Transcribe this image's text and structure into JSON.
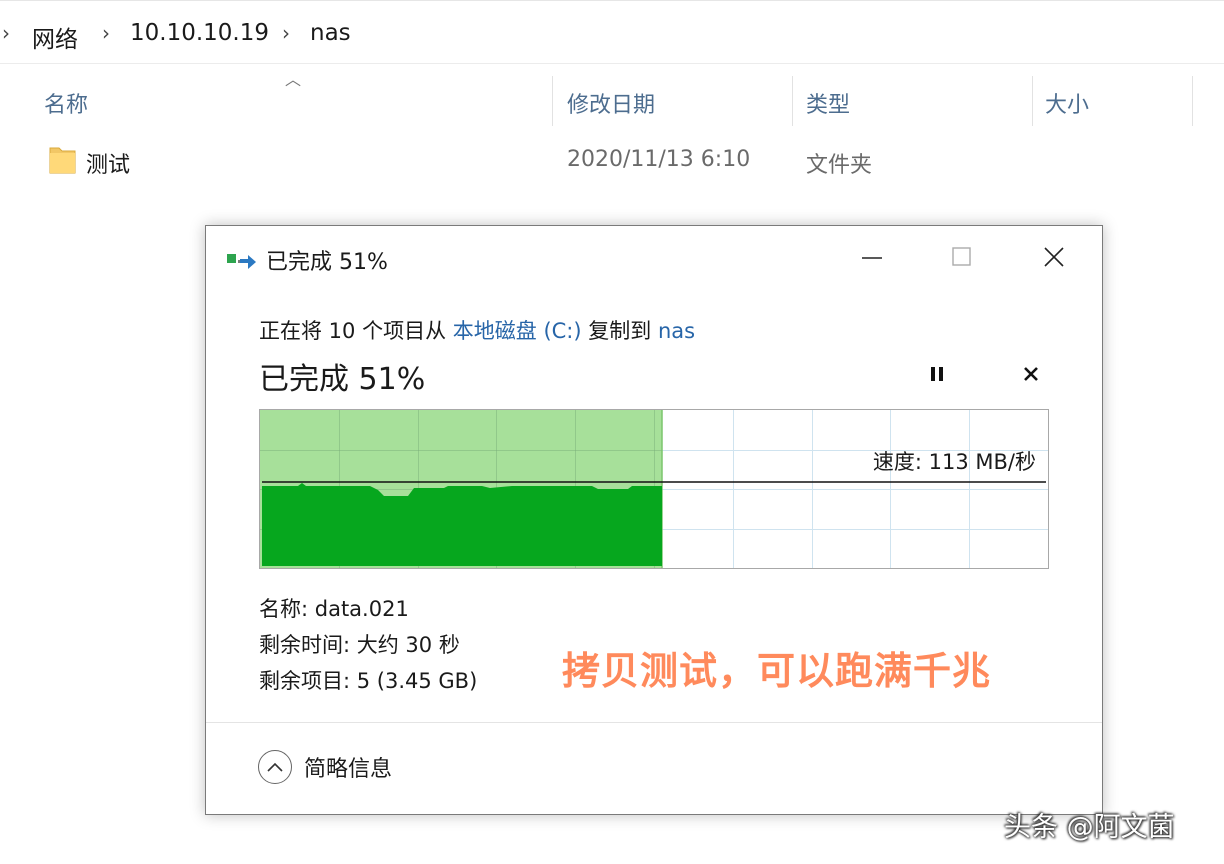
{
  "breadcrumb": {
    "items": [
      "网络",
      "10.10.10.19",
      "nas"
    ]
  },
  "columns": {
    "name": "名称",
    "modified": "修改日期",
    "type": "类型",
    "size": "大小"
  },
  "files": [
    {
      "name": "测试",
      "modified": "2020/11/13 6:10",
      "type": "文件夹",
      "icon": "folder-icon"
    }
  ],
  "dialog": {
    "title": "已完成 51%",
    "copy_prefix": "正在将 10 个项目从",
    "source": "本地磁盘 (C:)",
    "copy_mid": "复制到",
    "destination": "nas",
    "percent_text": "已完成 51%",
    "progress_fraction": 0.51,
    "speed": "速度: 113 MB/秒",
    "name_line": "名称: data.021",
    "time_left": "剩余时间: 大约 30 秒",
    "items_left": "剩余项目: 5 (3.45 GB)",
    "details_toggle": "简略信息",
    "colors": {
      "progress_fill": "#a7e09a",
      "throughput_fill": "#06a71e",
      "link": "#2765a8"
    }
  },
  "caption": "拷贝测试，可以跑满千兆",
  "watermark": "头条 @阿文菌"
}
